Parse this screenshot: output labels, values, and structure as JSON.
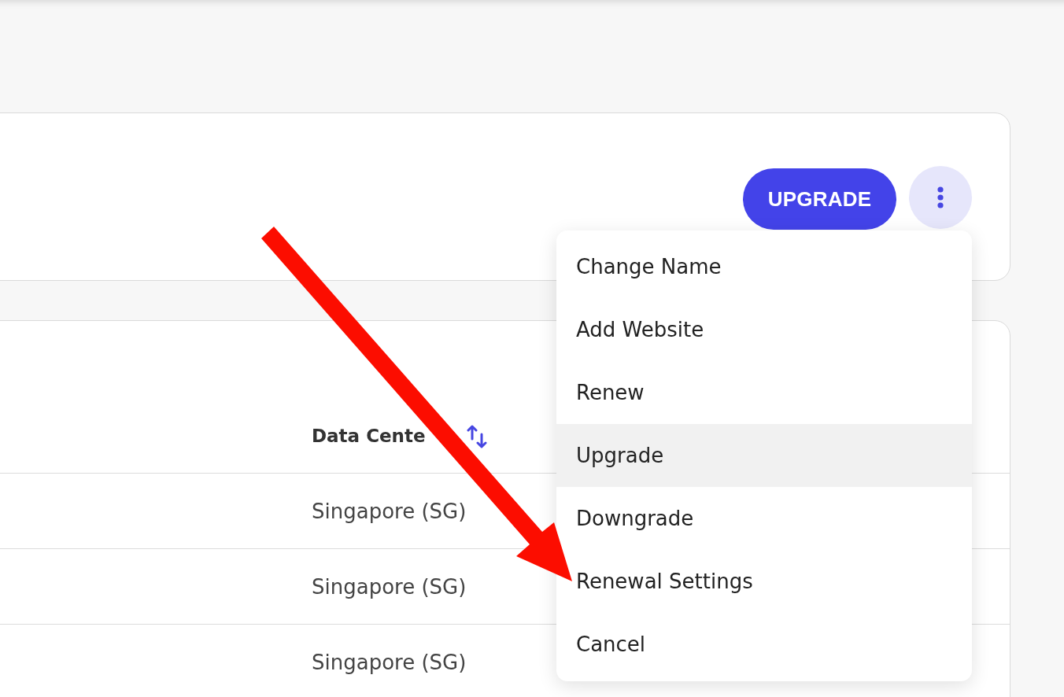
{
  "plan_card": {
    "upgrade_button": {
      "label": "UPGRADE"
    },
    "more_menu": {
      "expanded": true,
      "items": [
        {
          "label": "Change Name",
          "selected": false
        },
        {
          "label": "Add Website",
          "selected": false
        },
        {
          "label": "Renew",
          "selected": false
        },
        {
          "label": "Upgrade",
          "selected": true
        },
        {
          "label": "Downgrade",
          "selected": false
        },
        {
          "label": "Renewal Settings",
          "selected": false
        },
        {
          "label": "Cancel",
          "selected": false
        }
      ]
    }
  },
  "table": {
    "columns": [
      {
        "label": "Data Cente",
        "sortable": true
      }
    ],
    "rows": [
      {
        "cells": [
          "Singapore (SG)"
        ]
      },
      {
        "cells": [
          "Singapore (SG)"
        ]
      },
      {
        "cells": [
          "Singapore (SG)"
        ]
      }
    ]
  }
}
